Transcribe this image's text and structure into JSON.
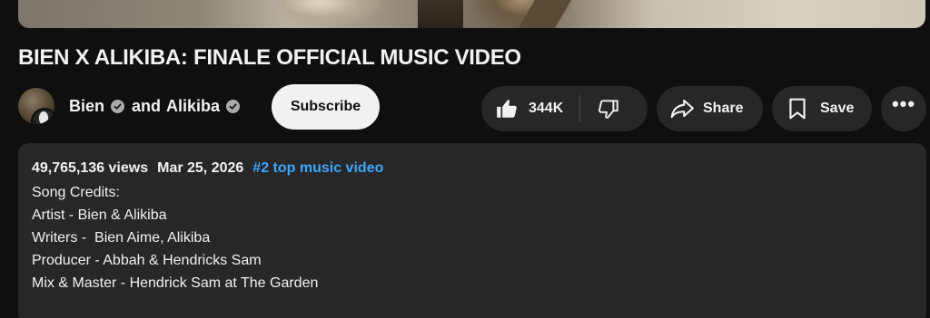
{
  "video": {
    "title": "BIEN X ALIKIBA: FINALE OFFICIAL MUSIC VIDEO"
  },
  "owner": {
    "channel_1": "Bien",
    "connector": "and",
    "channel_2": "Alikiba",
    "subscribe_label": "Subscribe"
  },
  "actions": {
    "like_count": "344K",
    "share_label": "Share",
    "save_label": "Save"
  },
  "description": {
    "views": "49,765,136 views",
    "date": "Mar 25, 2026",
    "tag": "#2 top music video",
    "lines": [
      "Song Credits:",
      "Artist - Bien & Alikiba",
      "Writers -  Bien Aime, Alikiba",
      "Producer - Abbah & Hendricks Sam",
      "Mix & Master - Hendrick Sam at The Garden"
    ]
  },
  "icons": {
    "like": "thumbs-up-icon",
    "dislike": "thumbs-down-icon",
    "share": "share-arrow-icon",
    "save": "bookmark-icon",
    "more": "more-horizontal-icon",
    "verified": "verified-check-icon"
  },
  "colors": {
    "background": "#0f0f0f",
    "pill": "#272727",
    "link": "#3ea6ff",
    "subscribe_bg": "#f1f1f1"
  }
}
